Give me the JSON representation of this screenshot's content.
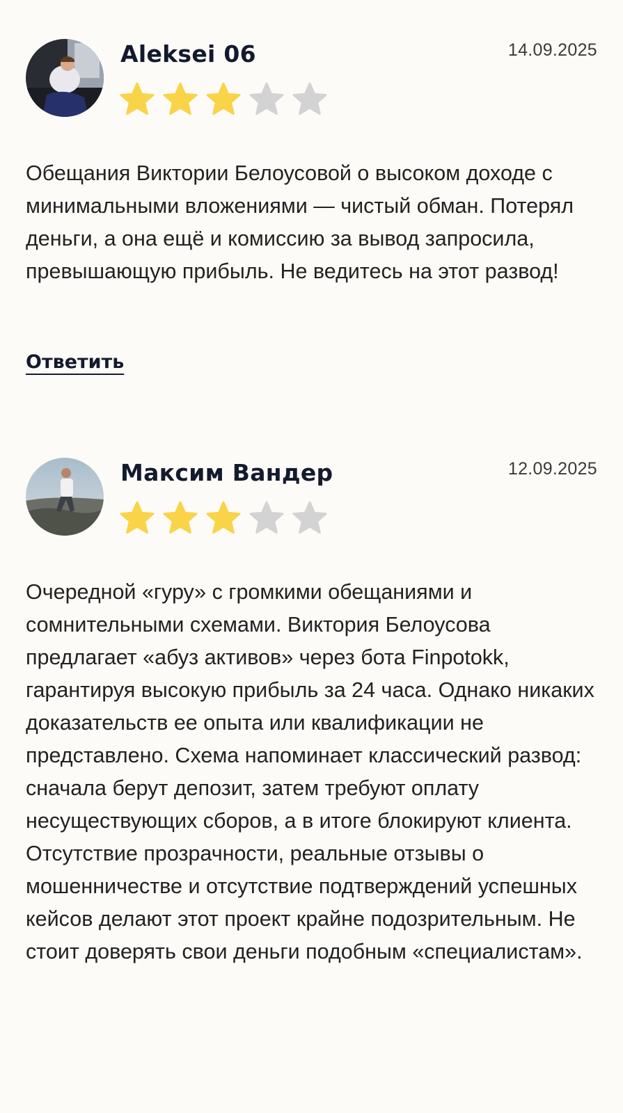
{
  "reviews": [
    {
      "author": "Aleksei 06",
      "date": "14.09.2025",
      "rating": 3,
      "rating_max": 5,
      "text": "Обещания Виктории Белоусовой о высоком доходе с минимальными вложениями — чистый обман. Потерял деньги, а она ещё и комиссию за вывод запросила, превышающую прибыль. Не ведитесь на этот развод!",
      "reply_label": "Ответить"
    },
    {
      "author": "Максим Вандер",
      "date": "12.09.2025",
      "rating": 3,
      "rating_max": 5,
      "text": "Очередной «гуру» с громкими обещаниями и сомнительными схемами. Виктория Белоусова предлагает «абуз активов» через бота Finpotokk, гарантируя высокую прибыль за 24 часа. Однако никаких доказательств ее опыта или квалификации не представлено. Схема напоминает классический развод: сначала берут депозит, затем требуют оплату несуществующих сборов, а в итоге блокируют клиента. Отсутствие прозрачности, реальные отзывы о мошенничестве и отсутствие подтверждений успешных кейсов делают этот проект крайне подозрительным. Не стоит доверять свои деньги подобным «специалистам»."
    }
  ],
  "colors": {
    "star_filled": "#f9d449",
    "star_empty": "#d3d3d3",
    "background": "#fdfbf8"
  }
}
